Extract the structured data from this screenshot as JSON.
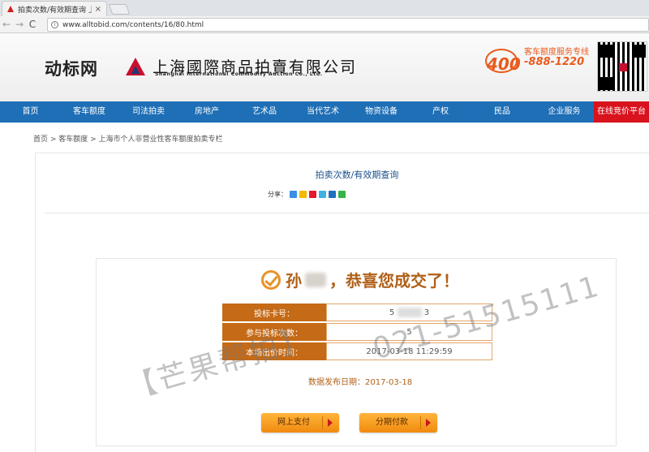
{
  "browser": {
    "tab_title": "拍卖次数/有效期查询 上",
    "tab_close": "×",
    "url": "www.alltobid.com/contents/16/80.html",
    "back": "←",
    "forward": "→",
    "reload": "C"
  },
  "header": {
    "site_logo": "动标网",
    "company_cn": "上海國際商品拍賣有限公司",
    "company_en": "Shanghai International Commodity Auction Co., Ltd.",
    "hotline_label": "客车额度服务专线",
    "hotline_prefix": "400",
    "hotline_number": "-888-1220"
  },
  "nav": {
    "items": [
      "首页",
      "客车额度",
      "司法拍卖",
      "房地产",
      "艺术品",
      "当代艺术",
      "物资设备",
      "产权",
      "民品",
      "企业服务"
    ],
    "live": "在线竞价平台"
  },
  "breadcrumb": "首页 > 客车额度 > 上海市个人非营业性客车额度拍卖专栏",
  "page": {
    "title": "拍卖次数/有效期查询",
    "share_label": "分享：",
    "share_icons": [
      "share-plus-icon",
      "qzone-icon",
      "weibo-icon",
      "tencent-weibo-icon",
      "renren-icon",
      "wechat-icon"
    ]
  },
  "result": {
    "surname": "孙",
    "congrats": "，恭喜您成交了！",
    "rows": [
      {
        "label": "投标卡号：",
        "value_prefix": "5",
        "value_suffix": "3"
      },
      {
        "label": "参与投标次数：",
        "value": "5"
      },
      {
        "label": "本场出价时间：",
        "value": "2017-03-18 11:29:59"
      }
    ],
    "publish_label": "数据发布日期：",
    "publish_date": "2017-03-18",
    "btn_pay_online": "网上支付",
    "btn_installment": "分期付款"
  },
  "watermark": {
    "brand": "【芒果帮拍】",
    "phone": "021-51515111"
  },
  "colors": {
    "nav_blue": "#1e6fb6",
    "live_red": "#d9131d",
    "label_brown": "#c56a16",
    "button_orange": "#f08a0f",
    "hotline_orange": "#e85b1c"
  }
}
